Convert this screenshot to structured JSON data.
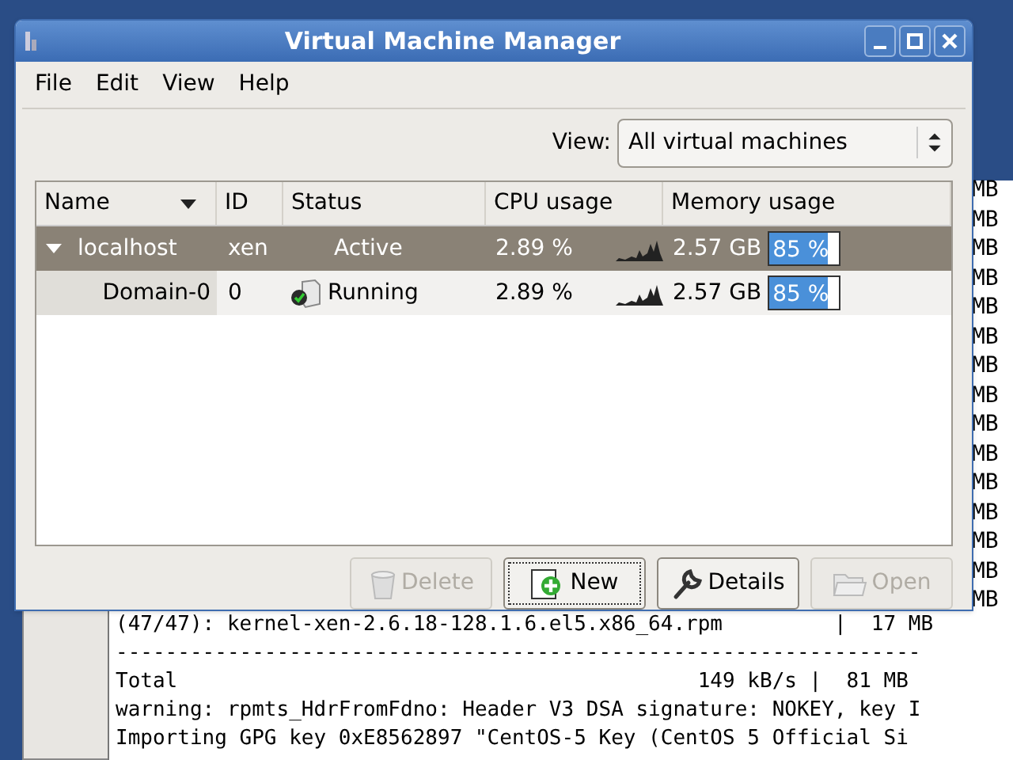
{
  "window": {
    "title": "Virtual Machine Manager"
  },
  "menu": [
    "File",
    "Edit",
    "View",
    "Help"
  ],
  "view_filter": {
    "label": "View:",
    "value": "All virtual machines"
  },
  "table": {
    "columns": [
      {
        "label": "Name",
        "sorted": true
      },
      {
        "label": "ID",
        "sorted": false
      },
      {
        "label": "Status",
        "sorted": false
      },
      {
        "label": "CPU usage",
        "sorted": false
      },
      {
        "label": "Memory usage",
        "sorted": false
      }
    ],
    "rows": [
      {
        "kind": "host",
        "name": "localhost",
        "id": "xen",
        "status": "Active",
        "cpu": "2.89 %",
        "memory": "2.57 GB",
        "level": 0.85,
        "reading": "85 %",
        "selected": true,
        "expanded": true,
        "children": [
          {
            "kind": "domain",
            "name": "Domain-0",
            "id": "0",
            "status": "Running",
            "cpu": "2.89 %",
            "memory": "2.57 GB",
            "level": 0.85,
            "reading": "85 %",
            "selected": false
          }
        ]
      }
    ]
  },
  "buttons": [
    {
      "label": "Delete",
      "kind": "delete",
      "disabled": true,
      "focused": false
    },
    {
      "label": "New",
      "kind": "new",
      "disabled": false,
      "focused": true
    },
    {
      "label": "Details",
      "kind": "details",
      "disabled": false,
      "focused": false
    },
    {
      "label": "Open",
      "kind": "open",
      "disabled": true,
      "focused": false
    }
  ],
  "terminal": {
    "side_lines": [
      "MB",
      "MB",
      "MB",
      "MB",
      "MB",
      "MB",
      "MB",
      "MB",
      "MB",
      "MB",
      "MB",
      "MB",
      "MB",
      "MB",
      "MB"
    ],
    "lines": [
      "(47/47): kernel-xen-2.6.18-128.1.6.el5.x86_64.rpm         |  17 MB",
      "-----------------------------------------------------------------",
      "Total                                          149 kB/s |  81 MB",
      "warning: rpmts_HdrFromFdno: Header V3 DSA signature: NOKEY, key I",
      "Importing GPG key 0xE8562897 \"CentOS-5 Key (CentOS 5 Official Si"
    ]
  }
}
